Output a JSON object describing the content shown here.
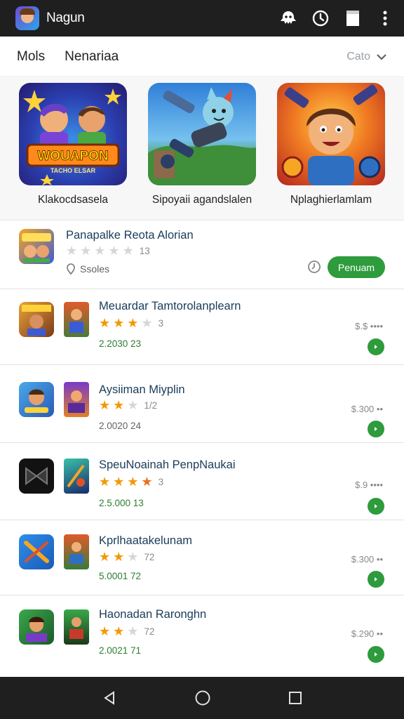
{
  "header": {
    "title": "Nagun",
    "icons": [
      "ghost-icon",
      "clock-icon",
      "document-icon",
      "more-vert-icon"
    ]
  },
  "tabs": [
    {
      "label": "Mols"
    },
    {
      "label": "Nenariaa"
    }
  ],
  "sort": {
    "label": "Cato"
  },
  "featured": [
    {
      "name": "Klakocdsasela",
      "art_text": "WOUAPON",
      "art_sub": "TACHO ELSAR"
    },
    {
      "name": "Sipoyaii agandslalen"
    },
    {
      "name": "Nplaghierlamlam"
    }
  ],
  "list": [
    {
      "title": "Panapalke Reota Alorian",
      "rating": 0,
      "rating_count": "13",
      "location": "Ssoles",
      "button": "Penuam"
    },
    {
      "title": "Meuardar Tamtorolanplearn",
      "rating": 3,
      "rating_count": "3",
      "sub": "2.2030 23",
      "price": "$.$ ••••"
    },
    {
      "title": "Aysiiman Miyplin",
      "rating": 2,
      "rating_count": "1/2",
      "sub": "2.0020 24",
      "price": "$.300 ••"
    },
    {
      "title": "SpeuNoainah PenpNaukai",
      "rating": 4,
      "rating_count": "3",
      "sub": "2.5.000 13",
      "price": "$.9 ••••"
    },
    {
      "title": "Kprlhaatakelunam",
      "rating": 2,
      "rating_count": "72",
      "sub": "5.0001 72",
      "price": "$.300 ••"
    },
    {
      "title": "Haonadan Raronghn",
      "rating": 2,
      "rating_count": "72",
      "sub": "2.0021 71",
      "price": "$.290 ••"
    }
  ],
  "navbar": {
    "icons": [
      "back-icon",
      "home-icon",
      "recents-icon"
    ]
  },
  "colors": {
    "accent_green": "#2e9b3d",
    "star": "#f29900",
    "bars": "#1f1f1f"
  }
}
